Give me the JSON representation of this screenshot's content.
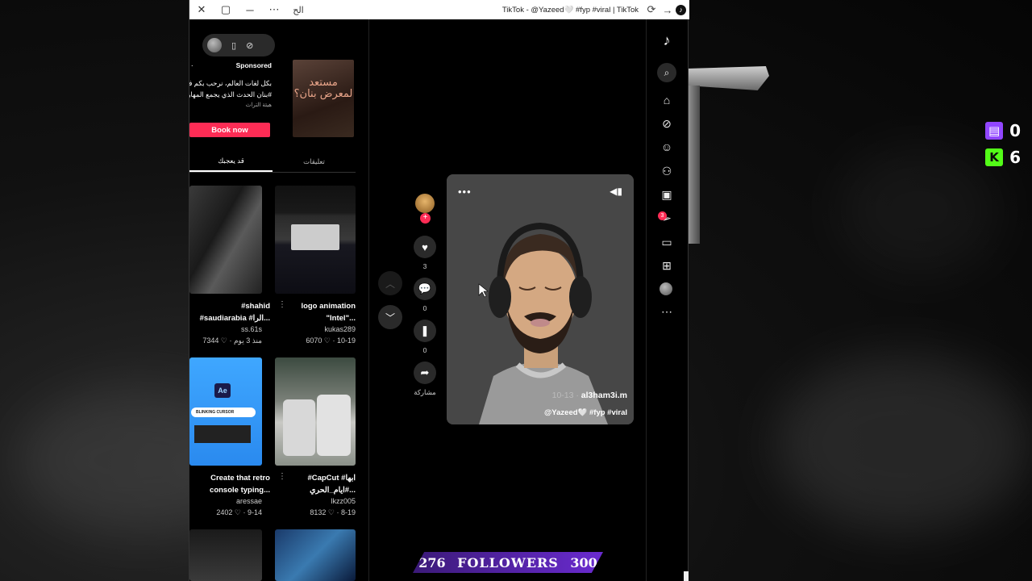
{
  "window": {
    "title": "TikTok - @Yazeed🤍 #fyp #viral | TikTok",
    "tab_glyph": "الح",
    "controls": [
      "✕",
      "□",
      "─",
      "⋯"
    ]
  },
  "stream": {
    "twitch_count": "0",
    "kick_count": "6",
    "kick_letter": "K",
    "followers_current": "276",
    "followers_label": "FOLLOWERS",
    "followers_goal": "300"
  },
  "ad": {
    "label": "Sponsored",
    "dot": ".",
    "title": "بكل لغات العالم، نرحب بكم في #بنان الحدث الذي يجمع المهارة",
    "source": "هيئة التراث",
    "thumb_text": "مستعد لمعرض بنان؟",
    "cta": "Book now"
  },
  "tabs": [
    {
      "label": "قد يعجبك"
    },
    {
      "label": "تعليقات"
    }
  ],
  "cards": [
    {
      "title": "#shahid #saudiarabia #الرا...",
      "author": "ss.61s",
      "meta": "7344 ♡ · منذ 3 يوم"
    },
    {
      "title": "logo animation \"Intel\"...",
      "author": "kukas289",
      "meta": "6070 ♡ · 10-19"
    },
    {
      "title": "Create that retro console typing...",
      "author": "aressae",
      "meta": "2402 ♡ · 9-14",
      "thumb_ae": "Ae",
      "thumb_search": "BLINKING CURSOR"
    },
    {
      "title": "#CapCut #ابها #ايام_الحري...",
      "author": "lkzz005",
      "meta": "8132 ♡ · 8-19"
    }
  ],
  "video": {
    "author": "al3ham3i.m",
    "date": "10-13 · ",
    "caption": "@Yazeed🤍 #fyp #viral",
    "likes": "3",
    "comments": "0",
    "saves": "0",
    "share_label": "مشاركة"
  },
  "rail": {
    "inbox_badge": "3"
  },
  "icons": [
    "close-icon",
    "maximize-icon",
    "minimize-icon",
    "more-icon",
    "refresh-icon",
    "forward-icon",
    "tiktok-icon",
    "search-icon",
    "home-icon",
    "explore-icon",
    "following-icon",
    "friends-icon",
    "live-icon",
    "messages-icon",
    "activity-icon",
    "upload-icon",
    "heart-icon",
    "comment-icon",
    "bookmark-icon",
    "share-icon"
  ],
  "colors": {
    "accent": "#fe2c55",
    "twitch": "#9146ff",
    "kick": "#53fc18",
    "banner": "#5a24b8"
  }
}
